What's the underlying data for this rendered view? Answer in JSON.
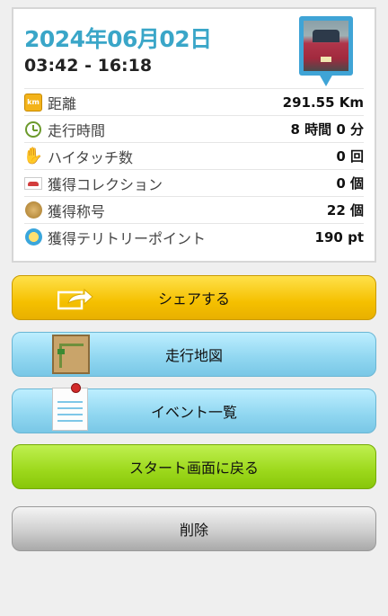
{
  "summary": {
    "date": "2024年06月02日",
    "time_range": "03:42 - 16:18"
  },
  "stats": [
    {
      "icon": "km-icon",
      "label": "距離",
      "value": "291.55 Km"
    },
    {
      "icon": "clock-icon",
      "label": "走行時間",
      "value": "8 時間 0 分"
    },
    {
      "icon": "hand-icon",
      "label": "ハイタッチ数",
      "value": "0 回"
    },
    {
      "icon": "car-icon",
      "label": "獲得コレクション",
      "value": "0 個"
    },
    {
      "icon": "medal-icon",
      "label": "獲得称号",
      "value": "22 個"
    },
    {
      "icon": "spot-icon",
      "label": "獲得テリトリーポイント",
      "value": "190 pt"
    }
  ],
  "buttons": {
    "share": "シェアする",
    "map": "走行地図",
    "events": "イベント一覧",
    "back_to_start": "スタート画面に戻る",
    "delete": "削除"
  },
  "colors": {
    "date": "#3aa6c8",
    "share": "#f5c000",
    "map": "#8fd6f0",
    "start": "#9cd81b",
    "delete": "#cfcfcf"
  }
}
